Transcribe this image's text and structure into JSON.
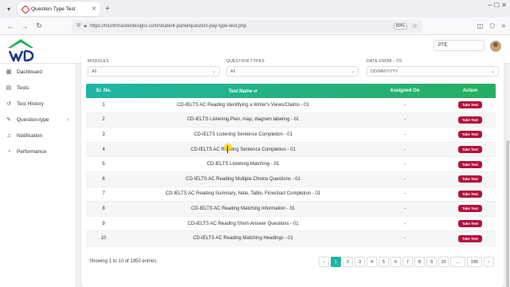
{
  "browser": {
    "tab_title": "Question Type Test",
    "tab_close": "✕",
    "new_tab": "+",
    "url": "https://fourthmasterdesigns.com/student-panel/question-pay-type-test.php",
    "zoom": "80%"
  },
  "header": {
    "lang_value": "PTE"
  },
  "sidebar": {
    "items": [
      {
        "label": "Dashboard",
        "icon": "dashboard-icon"
      },
      {
        "label": "Tests",
        "icon": "document-icon"
      },
      {
        "label": "Test History",
        "icon": "history-icon"
      },
      {
        "label": "Question-type",
        "icon": "edit-icon"
      },
      {
        "label": "Notification",
        "icon": "bell-icon"
      },
      {
        "label": "Performance",
        "icon": "speedometer-icon"
      }
    ]
  },
  "filters": {
    "modules_label": "MODULES",
    "modules_value": "All",
    "qtypes_label": "QUESTION TYPES",
    "qtypes_value": "All",
    "date_label": "DATE FROM - TO",
    "date_value": "DD/MM/YYYY"
  },
  "table": {
    "headers": {
      "sr": "Sr. No.",
      "name": "Test Name ⇌",
      "assigned": "Assigned On",
      "action": "Action"
    },
    "button_label": "Take Test",
    "rows": [
      {
        "sr": "1",
        "name": "CD-IELTS AC Reading Identifying a Writer's Views/Claims - 01",
        "assigned": "-"
      },
      {
        "sr": "2",
        "name": "CD-IELTS Listening Plan, map, diagram labeling - 01",
        "assigned": "-"
      },
      {
        "sr": "3",
        "name": "CD-IELTS Listening Sentence Completion - 01",
        "assigned": "-"
      },
      {
        "sr": "4",
        "name": "CD-IELTS AC Reading Sentence Completion - 01",
        "assigned": "-"
      },
      {
        "sr": "5",
        "name": "CD-IELTS Listening Matching - 01",
        "assigned": "-"
      },
      {
        "sr": "6",
        "name": "CD-IELTS AC Reading Multiple Choice Questions - 01",
        "assigned": "-"
      },
      {
        "sr": "7",
        "name": "CD-IELTS AC Reading Summary, Note, Table, Flowchart Completion - 01",
        "assigned": "-"
      },
      {
        "sr": "8",
        "name": "CD-IELTS AC Reading Matching Information - 01",
        "assigned": "-"
      },
      {
        "sr": "9",
        "name": "CD-IELTS AC Reading Short-Answer Questions - 01",
        "assigned": "-"
      },
      {
        "sr": "10",
        "name": "CD-IELTS AC Reading Matching Headings - 01",
        "assigned": "-"
      }
    ]
  },
  "footer": {
    "entries_text": "Showing 1 to 10 of 1950 entries",
    "pages": [
      "1",
      "2",
      "3",
      "4",
      "5",
      "6",
      "7",
      "8",
      "9",
      "10",
      "...",
      "195"
    ],
    "prev": "‹",
    "next": "›"
  },
  "colors": {
    "accent": "#1fb6a4",
    "button": "#b3123c"
  }
}
